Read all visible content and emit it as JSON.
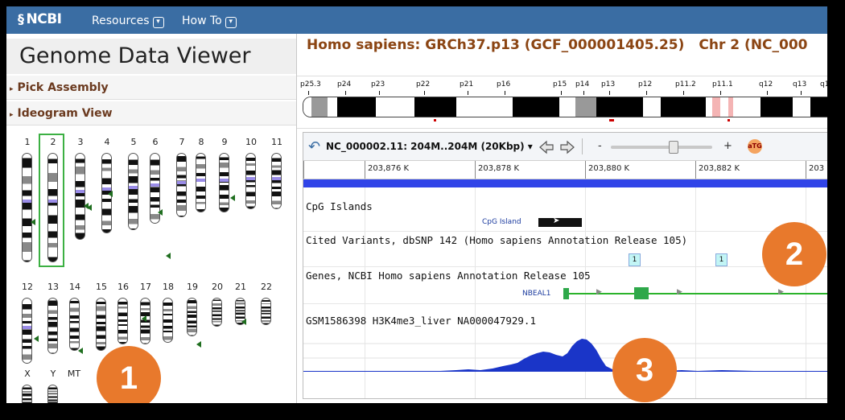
{
  "topbar": {
    "logo_glyph": "§",
    "logo": "NCBI",
    "menus": [
      {
        "label": "Resources",
        "arrow": "▾"
      },
      {
        "label": "How To",
        "arrow": "▾"
      }
    ]
  },
  "left_panel": {
    "title": "Genome Data Viewer",
    "sections": [
      {
        "label": "Pick Assembly",
        "icon": "▸"
      },
      {
        "label": "Ideogram View",
        "icon": "▸"
      }
    ],
    "chromosome_labels": [
      "1",
      "2",
      "3",
      "4",
      "5",
      "6",
      "7",
      "8",
      "9",
      "10",
      "11",
      "12",
      "13",
      "14",
      "15",
      "16",
      "17",
      "18",
      "19",
      "20",
      "21",
      "22",
      "X",
      "Y",
      "MT"
    ],
    "selected_chromosome": "2"
  },
  "right_panel": {
    "assembly_title": "Homo sapiens: GRCh37.p13 (GCF_000001405.25)",
    "chromosome_title": "Chr 2 (NC_000",
    "band_labels": [
      "p25.3",
      "p24",
      "p23",
      "p22",
      "p21",
      "p16",
      "p15",
      "p14",
      "p13",
      "p12",
      "p11.2",
      "p11.1",
      "q12",
      "q13",
      "q1"
    ],
    "sequence_viewer": {
      "accession": "NC_000002.11: 204M..204M (20Kbp)",
      "dropdown_arrow": "▾",
      "zoom_out": "-",
      "zoom_in": "+",
      "atg_label": "aTG",
      "ruler_labels": [
        "203,876 K",
        "203,878 K",
        "203,880 K",
        "203,882 K",
        "203"
      ],
      "tracks": [
        {
          "title": "CpG Islands"
        },
        {
          "title": "Cited Variants, dbSNP 142 (Homo sapiens Annotation Release 105)"
        },
        {
          "title": "Genes, NCBI Homo sapiens Annotation Release 105"
        },
        {
          "title": "GSM1586398 H3K4me3_liver NA000047929.1"
        }
      ],
      "cpg_feature": "CpG Island",
      "variant_counts": [
        "1",
        "1"
      ],
      "gene_name": "NBEAL1"
    }
  },
  "callouts": [
    "1",
    "2",
    "3"
  ],
  "colors": {
    "topbar": "#3a6da3",
    "callout": "#e8792c",
    "assembly_title": "#8b4513",
    "coverage": "#1a35c8",
    "gene": "#2ea84a"
  }
}
